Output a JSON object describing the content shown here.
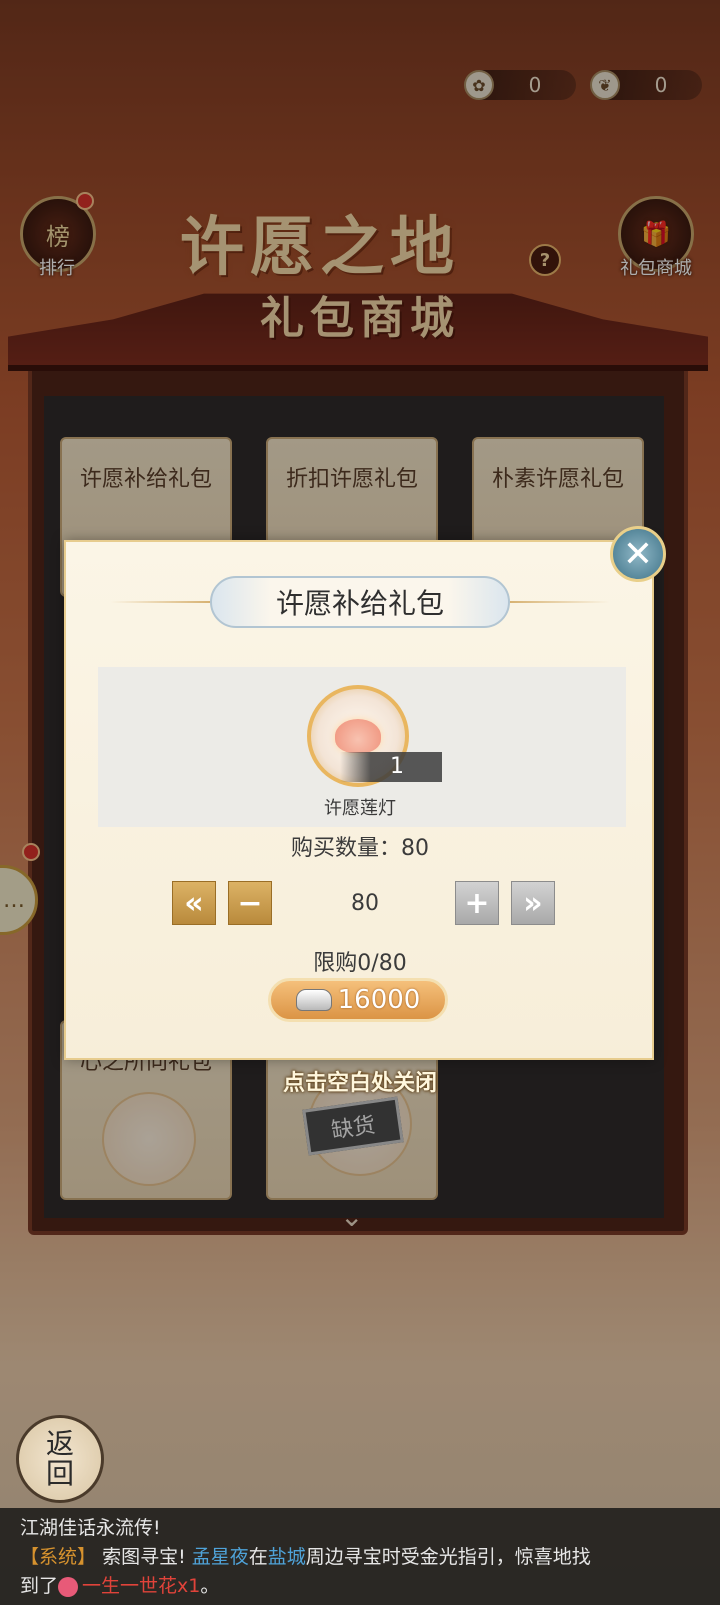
{
  "currency": [
    {
      "icon": "lotus-coin-icon",
      "value": "0"
    },
    {
      "icon": "leaf-coin-icon",
      "value": "0"
    }
  ],
  "side_left": {
    "rank_label": "排行",
    "rank_badge": "榜"
  },
  "side_right": {
    "giftshop_label": "礼包商城"
  },
  "page_title": "许愿之地",
  "help": "?",
  "shop": {
    "title": "礼包商城",
    "cards": [
      {
        "title": "许愿补给礼包"
      },
      {
        "title": "折扣许愿礼包"
      },
      {
        "title": "朴素许愿礼包"
      },
      {
        "title": "心之所向礼包"
      },
      {
        "title": ""
      }
    ],
    "out_of_stock": "缺货"
  },
  "dialog": {
    "title": "许愿补给礼包",
    "close_icon": "close-icon",
    "item": {
      "name": "许愿莲灯",
      "count": "1"
    },
    "buy_qty_label": "购买数量：80",
    "qty_value": "80",
    "limit_text": "限购0/80",
    "price": "16000",
    "buttons": {
      "min": "«",
      "minus": "−",
      "plus": "+",
      "max": "»"
    }
  },
  "close_hint": "点击空白处关闭",
  "back_button": {
    "line1": "返",
    "line2": "回"
  },
  "chat": {
    "line1": "江湖佳话永流传!",
    "sys_tag": "【系统】",
    "msg_a": "索图寻宝!",
    "player": "孟星夜",
    "msg_b": "在",
    "place": "盐城",
    "msg_c": "周边寻宝时受金光指引，惊喜地找",
    "msg_d": "到了",
    "item": "一生一世花x1",
    "msg_e": "。"
  },
  "colors": {
    "accent_gold": "#dcb265",
    "system_orange": "#d6922e",
    "link_blue": "#4fa3d9",
    "item_red": "#e0433a"
  }
}
